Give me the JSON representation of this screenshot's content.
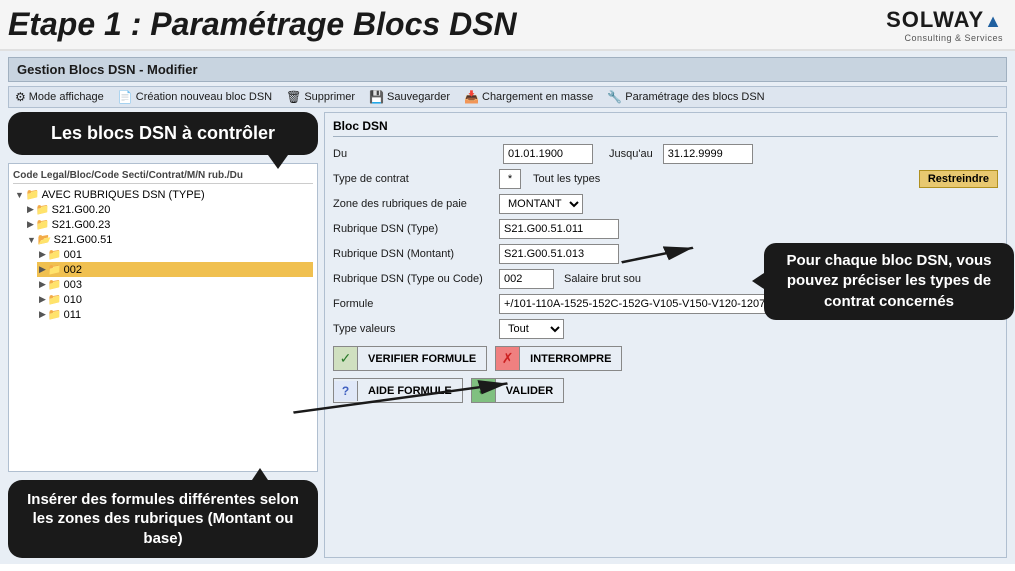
{
  "header": {
    "title": "Etape 1 : Paramétrage Blocs DSN",
    "logo_main": "SOLWAY",
    "logo_slash": "▲",
    "logo_sub": "Consulting & Services"
  },
  "window": {
    "title": "Gestion Blocs DSN - Modifier"
  },
  "toolbar": {
    "mode_affichage": "Mode affichage",
    "creation": "Création nouveau bloc DSN",
    "supprimer": "Supprimer",
    "sauvegarder": "Sauvegarder",
    "chargement": "Chargement en masse",
    "parametrage": "Paramétrage des blocs DSN"
  },
  "left_panel": {
    "bubble_blocs": "Les blocs DSN à contrôler",
    "tree_header": "Code Legal/Bloc/Code Secti/Contrat/M/N rub./Du",
    "tree_items": [
      {
        "level": 0,
        "label": "AVEC RUBRIQUES DSN (TYPE)",
        "type": "root"
      },
      {
        "level": 1,
        "label": "S21.G00.20",
        "type": "folder"
      },
      {
        "level": 1,
        "label": "S21.G00.23",
        "type": "folder"
      },
      {
        "level": 1,
        "label": "S21.G00.51",
        "type": "folder-open"
      },
      {
        "level": 2,
        "label": "001",
        "type": "folder"
      },
      {
        "level": 2,
        "label": "002",
        "type": "folder",
        "selected": true
      },
      {
        "level": 2,
        "label": "003",
        "type": "folder"
      },
      {
        "level": 2,
        "label": "010",
        "type": "folder"
      },
      {
        "level": 2,
        "label": "011",
        "type": "folder"
      }
    ],
    "bubble_formules": "Insérer des formules différentes selon les zones des rubriques (Montant ou base)"
  },
  "right_panel": {
    "bloc_dsn_label": "Bloc DSN",
    "du_label": "Du",
    "du_value": "01.01.1900",
    "jusquau_label": "Jusqu'au",
    "jusquau_value": "31.12.9999",
    "type_contrat_label": "Type de contrat",
    "type_contrat_dot": "*",
    "type_contrat_text": "Tout les types",
    "btn_restreindre": "Restreindre",
    "zone_rubriques_label": "Zone des rubriques de paie",
    "zone_dropdown": "MONTANT",
    "rubrique_type_label": "Rubrique DSN (Type)",
    "rubrique_type_value": "S21.G00.51.011",
    "rubrique_montant_label": "Rubrique DSN (Montant)",
    "rubrique_montant_value": "S21.G00.51.013",
    "rubrique_code_label": "Rubrique DSN (Type ou Code)",
    "rubrique_code_value": "002",
    "rubrique_code_text": "Salaire brut sou",
    "formule_label": "Formule",
    "formule_value": "+/101-110A-1525-152C-152G-V105-V150-V120-1207-120...",
    "type_valeurs_label": "Type valeurs",
    "type_valeurs_value": "Tout",
    "btn_verifier": "VERIFIER FORMULE",
    "btn_interrompre": "INTERROMPRE",
    "btn_aide": "AIDE FORMULE",
    "btn_valider": "VALIDER",
    "bubble_types": "Pour chaque bloc DSN, vous pouvez préciser les types de contrat concernés"
  }
}
